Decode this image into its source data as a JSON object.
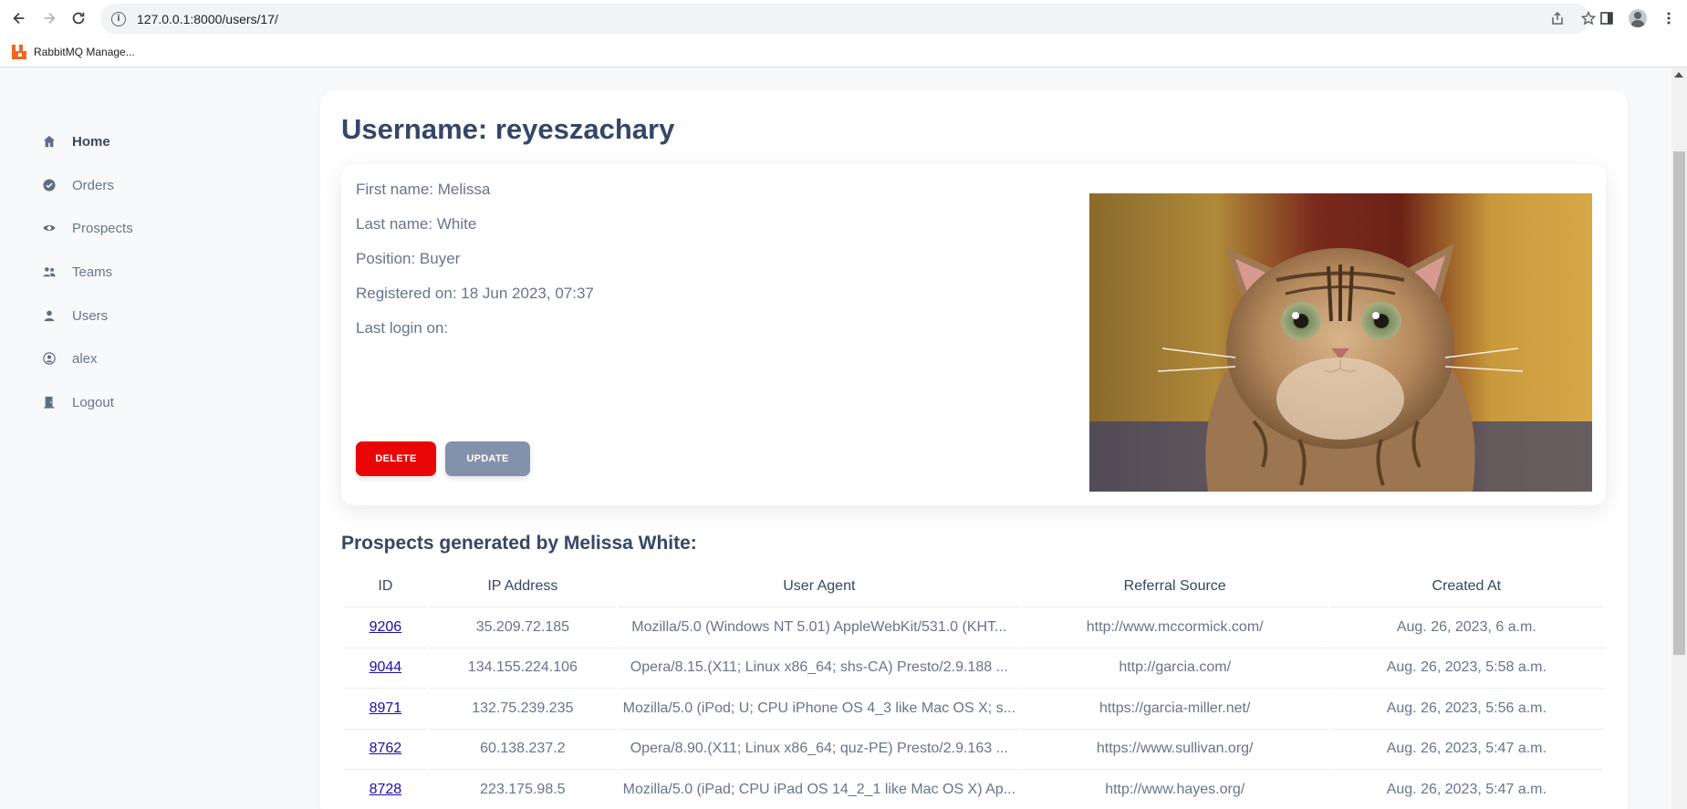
{
  "browser": {
    "url": "127.0.0.1:8000/users/17/",
    "bookmark_label": "RabbitMQ Manage..."
  },
  "sidebar": {
    "items": [
      {
        "label": "Home",
        "icon": "home-icon"
      },
      {
        "label": "Orders",
        "icon": "check-circle-icon"
      },
      {
        "label": "Prospects",
        "icon": "eye-icon"
      },
      {
        "label": "Teams",
        "icon": "people-icon"
      },
      {
        "label": "Users",
        "icon": "person-icon"
      },
      {
        "label": "alex",
        "icon": "user-circle-icon"
      },
      {
        "label": "Logout",
        "icon": "door-icon"
      }
    ]
  },
  "profile": {
    "title": "Username: reyeszachary",
    "first_name": "First name: Melissa",
    "last_name": "Last name: White",
    "position": "Position: Buyer",
    "registered": "Registered on: 18 Jun 2023, 07:37",
    "last_login": "Last login on:",
    "delete_label": "DELETE",
    "update_label": "UPDATE"
  },
  "prospects": {
    "title": "Prospects generated by Melissa White:",
    "headers": [
      "ID",
      "IP Address",
      "User Agent",
      "Referral Source",
      "Created At"
    ],
    "rows": [
      {
        "id": "9206",
        "ip": "35.209.72.185",
        "ua": "Mozilla/5.0 (Windows NT 5.01) AppleWebKit/531.0 (KHT...",
        "ref": "http://www.mccormick.com/",
        "created": "Aug. 26, 2023, 6 a.m."
      },
      {
        "id": "9044",
        "ip": "134.155.224.106",
        "ua": "Opera/8.15.(X11; Linux x86_64; shs-CA) Presto/2.9.188 ...",
        "ref": "http://garcia.com/",
        "created": "Aug. 26, 2023, 5:58 a.m."
      },
      {
        "id": "8971",
        "ip": "132.75.239.235",
        "ua": "Mozilla/5.0 (iPod; U; CPU iPhone OS 4_3 like Mac OS X; s...",
        "ref": "https://garcia-miller.net/",
        "created": "Aug. 26, 2023, 5:56 a.m."
      },
      {
        "id": "8762",
        "ip": "60.138.237.2",
        "ua": "Opera/8.90.(X11; Linux x86_64; quz-PE) Presto/2.9.163 ...",
        "ref": "https://www.sullivan.org/",
        "created": "Aug. 26, 2023, 5:47 a.m."
      },
      {
        "id": "8728",
        "ip": "223.175.98.5",
        "ua": "Mozilla/5.0 (iPad; CPU iPad OS 14_2_1 like Mac OS X) Ap...",
        "ref": "http://www.hayes.org/",
        "created": "Aug. 26, 2023, 5:47 a.m."
      }
    ]
  },
  "colors": {
    "accent_text": "#344767",
    "muted_text": "#67748e",
    "delete": "#ea0606",
    "update": "#8392ab",
    "link": "#1a0dab"
  }
}
